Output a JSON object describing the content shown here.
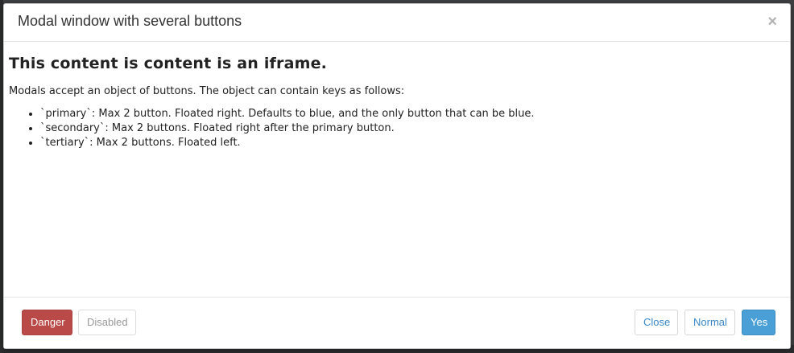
{
  "modal": {
    "title": "Modal window with several buttons",
    "close_icon": "×"
  },
  "content": {
    "heading": "This content is content is an iframe.",
    "intro": "Modals accept an object of buttons. The object can contain keys as follows:",
    "items": [
      "`primary`: Max 2 button. Floated right. Defaults to blue, and the only button that can be blue.",
      "`secondary`: Max 2 buttons. Floated right after the primary button.",
      "`tertiary`: Max 2 buttons. Floated left."
    ]
  },
  "footer": {
    "danger_label": "Danger",
    "disabled_label": "Disabled",
    "close_label": "Close",
    "normal_label": "Normal",
    "yes_label": "Yes"
  },
  "colors": {
    "danger": "#b94a48",
    "primary": "#4a9fd6",
    "link": "#3a87c8"
  }
}
